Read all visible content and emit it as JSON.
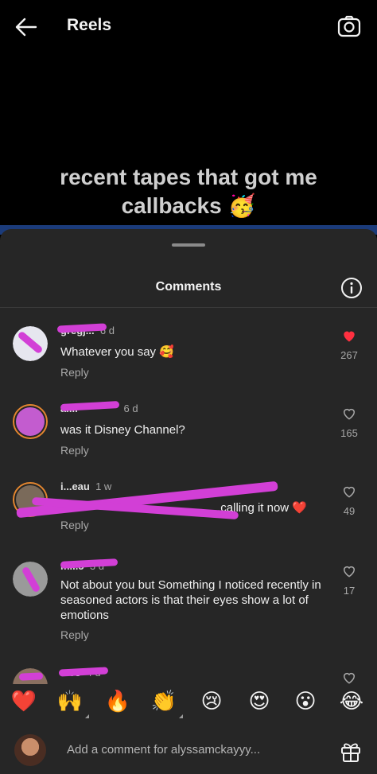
{
  "header": {
    "title": "Reels",
    "back_icon": "arrow-left-icon",
    "camera_icon": "camera-icon"
  },
  "video": {
    "caption_line1": "recent tapes that got me",
    "caption_line2": "callbacks",
    "caption_emoji": "🥳"
  },
  "sheet": {
    "title": "Comments"
  },
  "comments": [
    {
      "user": "gregj...",
      "time": "6 d",
      "text": "Whatever you say 🥰",
      "reply": "Reply",
      "likes": "267",
      "liked": true
    },
    {
      "user": "al...",
      "time": "6 d",
      "text": "was it Disney Channel?",
      "reply": "Reply",
      "likes": "165",
      "liked": false
    },
    {
      "user": "i...eau",
      "time": "1 w",
      "text": "...calling it now ❤️",
      "reply": "Reply",
      "likes": "49",
      "liked": false
    },
    {
      "user": "m...5",
      "time": "3 d",
      "text": "Not about you but Something I noticed recently in seasoned actors is that their eyes show a lot of emotions",
      "reply": "Reply",
      "likes": "17",
      "liked": false
    },
    {
      "user": "...03",
      "time": "4 d",
      "text": "",
      "reply": "",
      "likes": "",
      "liked": false
    }
  ],
  "reactions": [
    "❤️",
    "🙌",
    "🔥",
    "👏",
    "😢",
    "😍",
    "😮",
    "😂"
  ],
  "composer": {
    "placeholder": "Add a comment for alyssamckayyy..."
  },
  "colors": {
    "like_red": "#ff3040",
    "scribble": "#d23fd6",
    "sheet_bg": "#262626"
  }
}
